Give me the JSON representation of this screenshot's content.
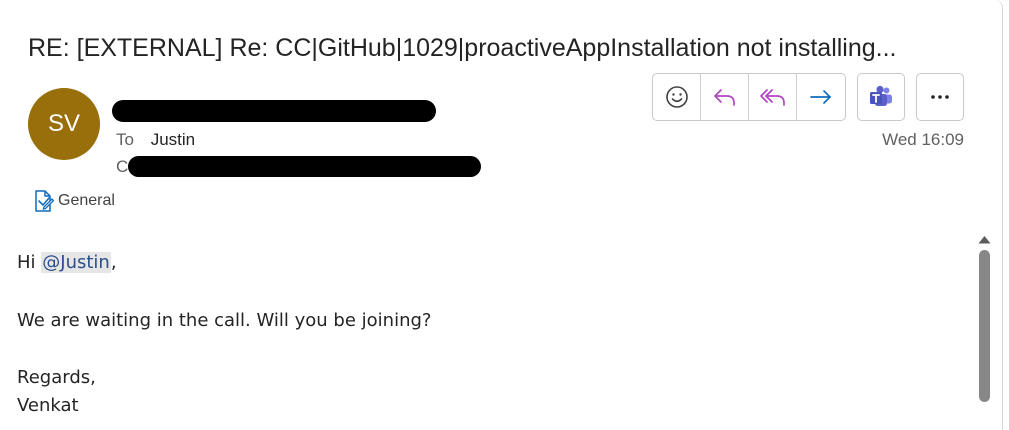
{
  "email": {
    "subject": "RE: [EXTERNAL] Re: CC|GitHub|1029|proactiveAppInstallation not installing...",
    "sender_initials": "SV",
    "to_label": "To",
    "to_name": "Justin",
    "cc_label": "C",
    "date": "Wed 16:09",
    "category_label": "General",
    "body": {
      "greeting_prefix": "Hi ",
      "mention": "@Justin",
      "greeting_suffix": ",",
      "line1": "We are waiting in the call. Will you be joining?",
      "signoff": "Regards,",
      "signature": "Venkat"
    }
  },
  "actions": {
    "icons": [
      "smiley-icon",
      "reply-icon",
      "reply-all-icon",
      "forward-icon",
      "teams-icon",
      "more-icon"
    ]
  },
  "colors": {
    "avatar": "#986f0b",
    "reply_accent": "#b146c2",
    "forward_accent": "#0f6cbd",
    "teams": "#5b5fc7",
    "mention_text": "#2b4e8c"
  }
}
